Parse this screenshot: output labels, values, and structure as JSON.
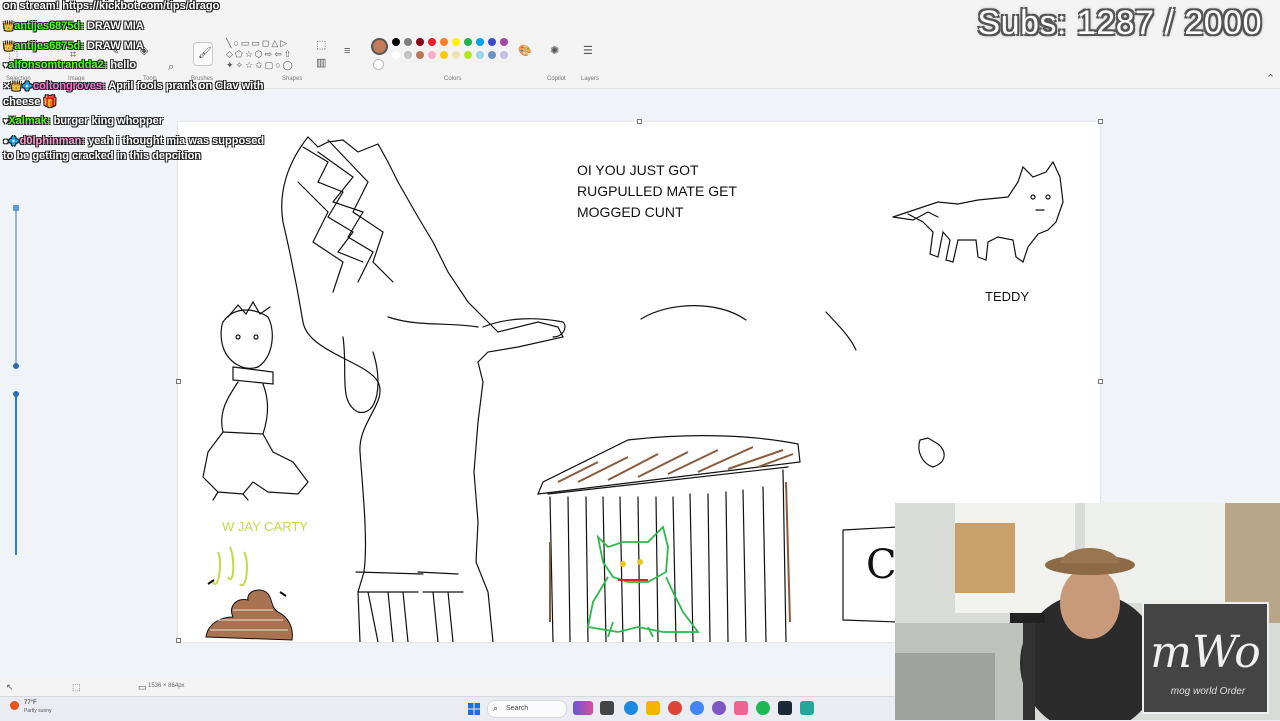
{
  "chat": [
    {
      "user": "",
      "user_color": "#ffffff",
      "badges": "",
      "message": "on stream! https://kickbot.com/tips/drago"
    },
    {
      "user": "antijes6875d:",
      "user_color": "#53fc18",
      "badges": "👑",
      "message": "DRAW MIA"
    },
    {
      "user": "antijes6875d:",
      "user_color": "#53fc18",
      "badges": "👑",
      "message": "DRAW MIA"
    },
    {
      "user": "alfonsomtrandda2:",
      "user_color": "#53fc18",
      "badges": "♥",
      "message": "hello"
    },
    {
      "user": "coltongroves:",
      "user_color": "#ff6ad5",
      "badges": "✕👑💠",
      "message": "April fools prank on Clav with"
    },
    {
      "user": "",
      "user_color": "#ffffff",
      "badges": "",
      "message": "cheese 🎁"
    },
    {
      "user": "Xalmak:",
      "user_color": "#53fc18",
      "badges": "♥",
      "message": "burger king whopper"
    },
    {
      "user": "d0lphinman:",
      "user_color": "#ff9ad2",
      "badges": "●💠",
      "message": "yeah i thought mia was supposed"
    },
    {
      "user": "",
      "user_color": "#ffffff",
      "badges": "",
      "message": "to be getting cracked in this depcition"
    }
  ],
  "subs": {
    "text": "Subs: 1287 / 2000"
  },
  "ribbon": {
    "labels": {
      "selection": "Selection",
      "image": "Image",
      "tools": "Tools",
      "brushes": "Brushes",
      "shapes": "Shapes",
      "colors": "Colors",
      "copilot": "Copilot",
      "layers": "Layers"
    },
    "colors_row1": [
      "#000000",
      "#7f7f7f",
      "#880015",
      "#ed1c24",
      "#ff7f27",
      "#fff200",
      "#22b14c",
      "#00a2e8",
      "#3f48cc",
      "#a349a4"
    ],
    "colors_row2": [
      "#ffffff",
      "#c3c3c3",
      "#b97a57",
      "#ffaec9",
      "#ffc90e",
      "#efe4b0",
      "#b5e61d",
      "#99d9ea",
      "#7092be",
      "#c8bfe7"
    ],
    "current_color": "#c47b57"
  },
  "canvas": {
    "caption": [
      "OI YOU JUST GOT",
      "RUGPULLED MATE GET",
      "MOGGED CUNT"
    ],
    "teddy_label": "TEDDY",
    "carty_label": "W JAY CARTY",
    "partial_letter": "C"
  },
  "statusbar": {
    "dimensions": "1536 × 864px"
  },
  "taskbar": {
    "weather_temp": "77°F",
    "weather_desc": "Partly sunny",
    "search_label": "Search"
  },
  "webcam": {
    "logo_text": "mog world Order"
  }
}
